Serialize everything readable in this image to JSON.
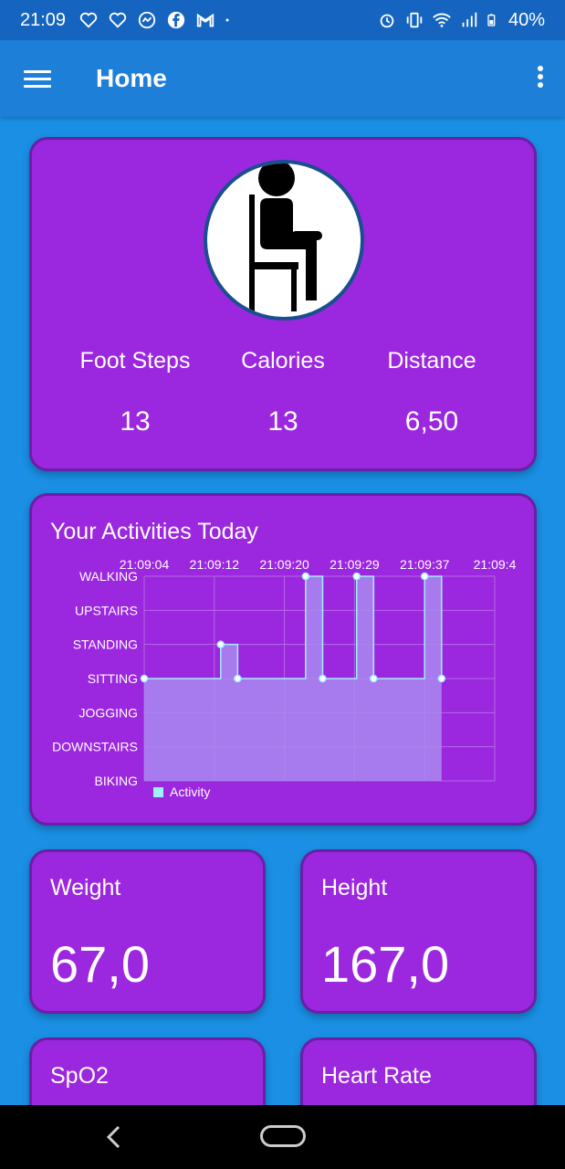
{
  "status_bar": {
    "time": "21:09",
    "battery": "40%",
    "notification_icons": [
      "heart-icon",
      "heart-icon",
      "messenger-icon",
      "facebook-icon",
      "gmail-icon",
      "dot-icon"
    ],
    "system_icons": [
      "alarm-icon",
      "vibrate-icon",
      "wifi-icon",
      "signal-icon",
      "battery-icon"
    ]
  },
  "app_bar": {
    "title": "Home"
  },
  "profile": {
    "activity_icon": "sitting-person-icon",
    "stats": [
      {
        "label": "Foot Steps",
        "value": "13"
      },
      {
        "label": "Calories",
        "value": "13"
      },
      {
        "label": "Distance",
        "value": "6,50"
      }
    ]
  },
  "activities": {
    "title": "Your Activities Today"
  },
  "chart_data": {
    "type": "line",
    "title": "Your Activities Today",
    "x_tick_labels": [
      "21:09:04",
      "21:09:12",
      "21:09:20",
      "21:09:29",
      "21:09:37",
      "21:09:4"
    ],
    "y_categories": [
      "WALKING",
      "UPSTAIRS",
      "STANDING",
      "SITTING",
      "JOGGING",
      "DOWNSTAIRS",
      "BIKING"
    ],
    "series": [
      {
        "name": "Activity",
        "color": "#a0f0ff",
        "points": [
          {
            "x": "21:09:04",
            "y": "SITTING"
          },
          {
            "x": "21:09:13",
            "y": "STANDING"
          },
          {
            "x": "21:09:15",
            "y": "SITTING"
          },
          {
            "x": "21:09:23",
            "y": "WALKING"
          },
          {
            "x": "21:09:25",
            "y": "SITTING"
          },
          {
            "x": "21:09:29",
            "y": "WALKING"
          },
          {
            "x": "21:09:31",
            "y": "SITTING"
          },
          {
            "x": "21:09:37",
            "y": "WALKING"
          },
          {
            "x": "21:09:39",
            "y": "SITTING"
          }
        ]
      }
    ],
    "legend": "bottom-left",
    "grid": true,
    "area_fill": true
  },
  "metrics": {
    "weight": {
      "label": "Weight",
      "value": "67,0"
    },
    "height": {
      "label": "Height",
      "value": "167,0"
    },
    "spo2": {
      "label": "SpO2"
    },
    "heart_rate": {
      "label": "Heart Rate"
    }
  }
}
